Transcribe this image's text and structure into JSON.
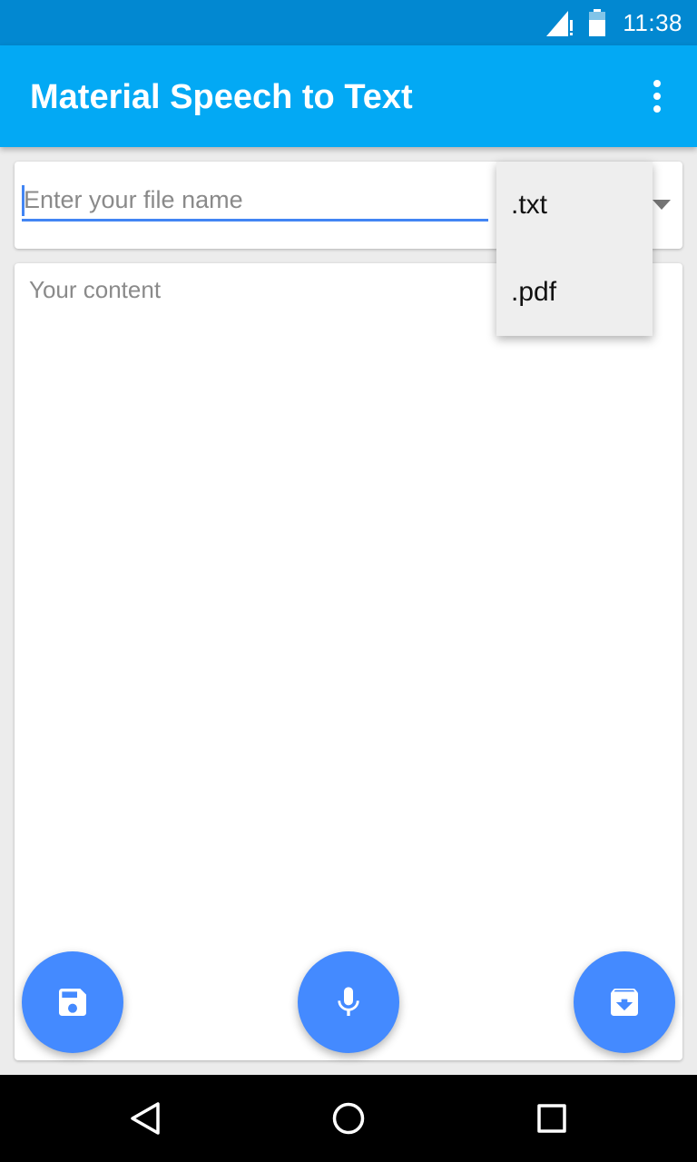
{
  "status_bar": {
    "time": "11:38",
    "icons": [
      "signal-icon",
      "battery-icon"
    ]
  },
  "app_bar": {
    "title": "Material Speech to Text",
    "menu_icon": "more-vert-icon"
  },
  "file_card": {
    "filename_placeholder": "Enter your file name",
    "filename_value": "",
    "dropdown_icon": "dropdown-arrow-icon"
  },
  "dropdown": {
    "options": [
      ".txt",
      ".pdf"
    ]
  },
  "content_card": {
    "placeholder": "Your content",
    "value": ""
  },
  "fabs": [
    {
      "icon": "save-icon"
    },
    {
      "icon": "mic-icon"
    },
    {
      "icon": "archive-download-icon"
    }
  ],
  "nav_bar": {
    "icons": [
      "back-icon",
      "home-icon",
      "recents-icon"
    ]
  },
  "colors": {
    "status_bar": "#0288d1",
    "app_bar": "#03a9f4",
    "accent": "#448aff",
    "background": "#ececec"
  }
}
